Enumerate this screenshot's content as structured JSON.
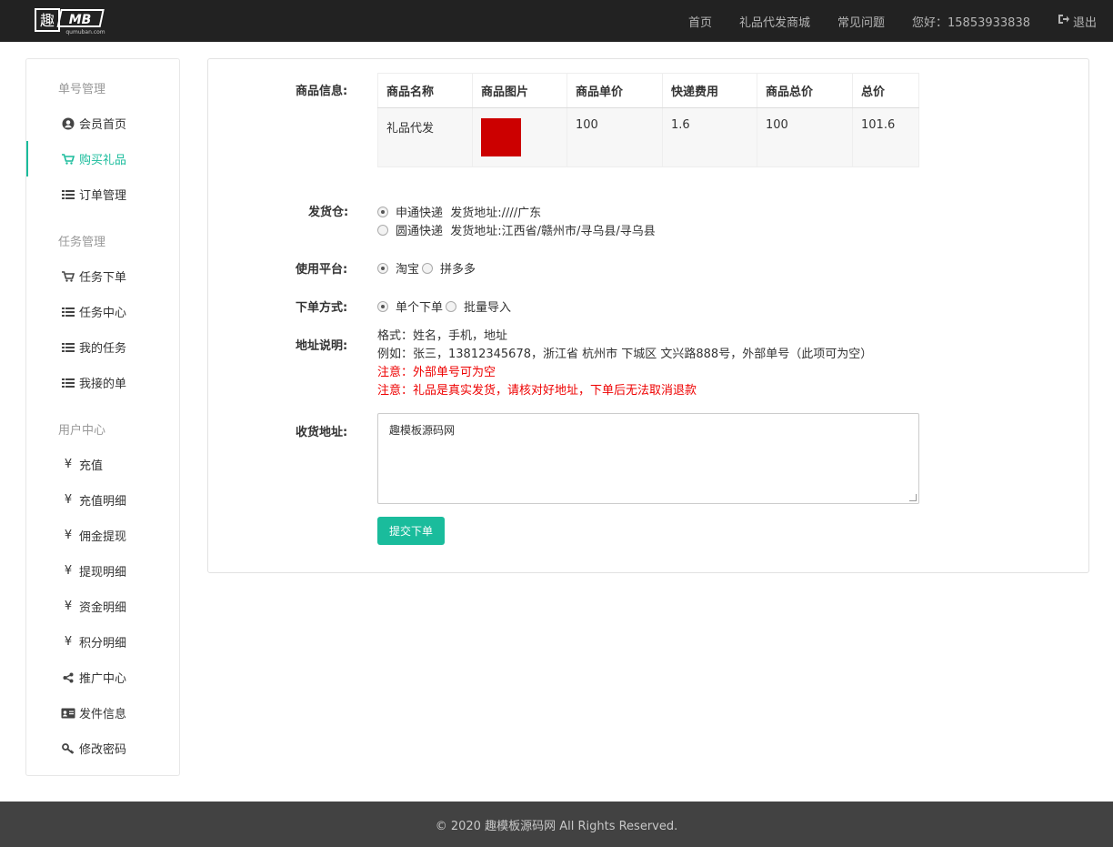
{
  "header": {
    "logo_text": "趣MB",
    "logo_sub": "qumuban.com",
    "nav": [
      {
        "label": "首页"
      },
      {
        "label": "礼品代发商城"
      },
      {
        "label": "常见问题"
      },
      {
        "label": "您好：15853933838"
      },
      {
        "label": "退出",
        "icon": "sign-out-icon"
      }
    ]
  },
  "sidebar": {
    "sections": [
      {
        "title": "单号管理",
        "items": [
          {
            "label": "会员首页",
            "icon": "user-circle-icon"
          },
          {
            "label": "购买礼品",
            "icon": "cart-icon",
            "active": true
          },
          {
            "label": "订单管理",
            "icon": "list-icon"
          }
        ]
      },
      {
        "title": "任务管理",
        "items": [
          {
            "label": "任务下单",
            "icon": "cart-icon"
          },
          {
            "label": "任务中心",
            "icon": "list-icon"
          },
          {
            "label": "我的任务",
            "icon": "list-icon"
          },
          {
            "label": "我接的单",
            "icon": "list-icon"
          }
        ]
      },
      {
        "title": "用户中心",
        "items": [
          {
            "label": "充值",
            "icon": "yen-icon"
          },
          {
            "label": "充值明细",
            "icon": "yen-icon"
          },
          {
            "label": "佣金提现",
            "icon": "yen-icon"
          },
          {
            "label": "提现明细",
            "icon": "yen-icon"
          },
          {
            "label": "资金明细",
            "icon": "yen-icon"
          },
          {
            "label": "积分明细",
            "icon": "yen-icon"
          },
          {
            "label": "推广中心",
            "icon": "share-icon"
          },
          {
            "label": "发件信息",
            "icon": "id-card-icon"
          },
          {
            "label": "修改密码",
            "icon": "key-icon"
          }
        ]
      }
    ]
  },
  "form": {
    "goods_label": "商品信息:",
    "table": {
      "headers": [
        "商品名称",
        "商品图片",
        "商品单价",
        "快递费用",
        "商品总价",
        "总价"
      ],
      "row": {
        "name": "礼品代发",
        "unit_price": "100",
        "shipping": "1.6",
        "goods_total": "100",
        "total": "101.6"
      }
    },
    "warehouse_label": "发货仓:",
    "warehouses": [
      {
        "label": "申通快递  发货地址:////广东",
        "checked": true
      },
      {
        "label": "圆通快递  发货地址:江西省/赣州市/寻乌县/寻乌县",
        "checked": false
      }
    ],
    "platform_label": "使用平台:",
    "platforms": [
      {
        "label": "淘宝",
        "checked": true
      },
      {
        "label": "拼多多",
        "checked": false
      }
    ],
    "order_mode_label": "下单方式:",
    "order_modes": [
      {
        "label": "单个下单",
        "checked": true
      },
      {
        "label": "批量导入",
        "checked": false
      }
    ],
    "address_desc_label": "地址说明:",
    "address_desc": {
      "format": "格式：姓名，手机，地址",
      "example": "例如：张三，13812345678，浙江省 杭州市 下城区 文兴路888号，外部单号（此项可为空）",
      "note1": "注意：外部单号可为空",
      "note2": "注意：礼品是真实发货，请核对好地址，下单后无法取消退款"
    },
    "ship_address_label": "收货地址:",
    "ship_address_value": "趣模板源码网",
    "submit_label": "提交下单"
  },
  "footer": {
    "text": "© 2020 趣模板源码网 All Rights Reserved."
  },
  "colors": {
    "accent": "#1abc9c",
    "topbar": "#222222",
    "footer": "#424242",
    "warning": "#ee0000"
  }
}
